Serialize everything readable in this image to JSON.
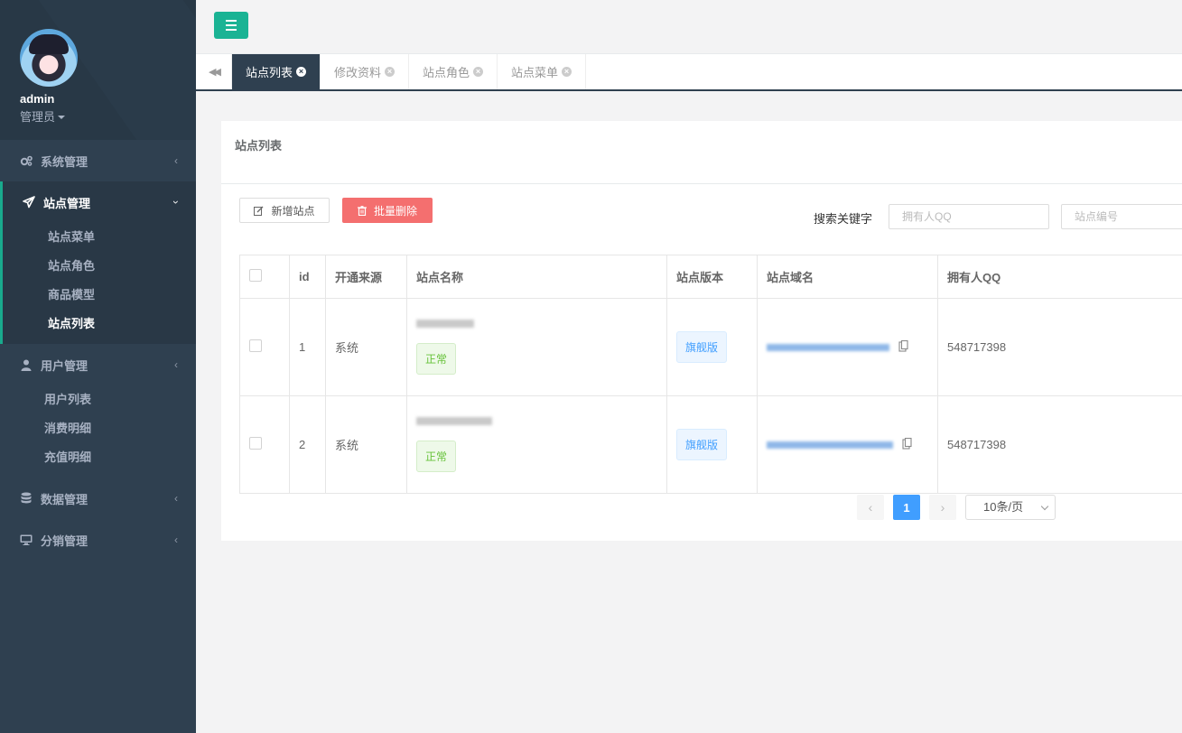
{
  "user": {
    "name": "admin",
    "role": "管理员"
  },
  "sidebar": {
    "items": [
      {
        "label": "系统管理",
        "icon": "cogs-icon",
        "arrow": "‹"
      },
      {
        "label": "站点管理",
        "icon": "paper-plane-icon",
        "arrow": "›",
        "children": [
          "站点菜单",
          "站点角色",
          "商品模型",
          "站点列表"
        ]
      },
      {
        "label": "用户管理",
        "icon": "user-icon",
        "arrow": "‹",
        "children": [
          "用户列表",
          "消费明细",
          "充值明细"
        ]
      },
      {
        "label": "数据管理",
        "icon": "database-icon",
        "arrow": "‹"
      },
      {
        "label": "分销管理",
        "icon": "desktop-icon",
        "arrow": "‹"
      }
    ]
  },
  "tabs": [
    "站点列表",
    "修改资料",
    "站点角色",
    "站点菜单"
  ],
  "panel": {
    "title": "站点列表"
  },
  "toolbar": {
    "add_label": "新增站点",
    "delete_label": "批量删除"
  },
  "search": {
    "label": "搜索关键字",
    "qq_placeholder": "拥有人QQ",
    "id_placeholder": "站点编号"
  },
  "table": {
    "headers": [
      "id",
      "开通来源",
      "站点名称",
      "站点版本",
      "站点域名",
      "拥有人QQ"
    ],
    "rows": [
      {
        "id": "1",
        "source": "系统",
        "status": "正常",
        "version": "旗舰版",
        "qq": "548717398"
      },
      {
        "id": "2",
        "source": "系统",
        "status": "正常",
        "version": "旗舰版",
        "qq": "548717398"
      }
    ]
  },
  "pagination": {
    "prev": "‹",
    "current": "1",
    "next": "›",
    "page_size": "10条/页"
  },
  "colors": {
    "sidebar": "#2f4050",
    "accent": "#1ab394",
    "danger": "#f46f6f",
    "primary": "#409eff"
  }
}
